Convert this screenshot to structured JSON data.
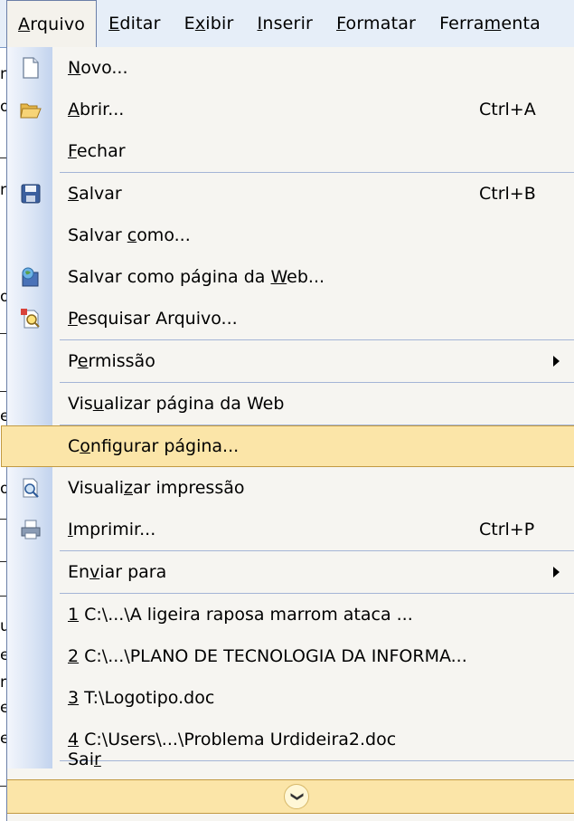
{
  "menubar": {
    "items": [
      {
        "pre": "",
        "ul": "A",
        "post": "rquivo"
      },
      {
        "pre": "",
        "ul": "E",
        "post": "ditar"
      },
      {
        "pre": "E",
        "ul": "x",
        "post": "ibir"
      },
      {
        "pre": "",
        "ul": "I",
        "post": "nserir"
      },
      {
        "pre": "",
        "ul": "F",
        "post": "ormatar"
      },
      {
        "pre": "Ferra",
        "ul": "m",
        "post": "enta"
      }
    ]
  },
  "menu": {
    "items": [
      {
        "pre": "",
        "ul": "N",
        "post": "ovo...",
        "shortcut": "",
        "icon": "new-document-icon"
      },
      {
        "pre": "",
        "ul": "A",
        "post": "brir...",
        "shortcut": "Ctrl+A",
        "icon": "open-folder-icon"
      },
      {
        "pre": "",
        "ul": "F",
        "post": "echar",
        "shortcut": "",
        "icon": ""
      },
      {
        "pre": "",
        "ul": "S",
        "post": "alvar",
        "shortcut": "Ctrl+B",
        "icon": "save-disk-icon"
      },
      {
        "pre": "Salvar ",
        "ul": "c",
        "post": "omo...",
        "shortcut": "",
        "icon": ""
      },
      {
        "pre": "Salvar como página da ",
        "ul": "W",
        "post": "eb...",
        "shortcut": "",
        "icon": "save-web-icon"
      },
      {
        "pre": "",
        "ul": "P",
        "post": "esquisar Arquivo...",
        "shortcut": "",
        "icon": "search-file-icon"
      },
      {
        "pre": "P",
        "ul": "e",
        "post": "rmissão",
        "shortcut": "",
        "icon": ""
      },
      {
        "pre": "Vis",
        "ul": "u",
        "post": "alizar página da Web",
        "shortcut": "",
        "icon": ""
      },
      {
        "pre": "C",
        "ul": "o",
        "post": "nfigurar página...",
        "shortcut": "",
        "icon": ""
      },
      {
        "pre": "Visuali",
        "ul": "z",
        "post": "ar impressão",
        "shortcut": "",
        "icon": "print-preview-icon"
      },
      {
        "pre": "",
        "ul": "I",
        "post": "mprimir...",
        "shortcut": "Ctrl+P",
        "icon": "printer-icon"
      },
      {
        "pre": "En",
        "ul": "v",
        "post": "iar para",
        "shortcut": "",
        "icon": ""
      },
      {
        "pre": "",
        "ul": "1",
        "post": " C:\\...\\A ligeira raposa marrom ataca ...",
        "shortcut": "",
        "icon": ""
      },
      {
        "pre": "",
        "ul": "2",
        "post": " C:\\...\\PLANO DE TECNOLOGIA DA INFORMA...",
        "shortcut": "",
        "icon": ""
      },
      {
        "pre": "",
        "ul": "3",
        "post": " T:\\Logotipo.doc",
        "shortcut": "",
        "icon": ""
      },
      {
        "pre": "",
        "ul": "4",
        "post": " C:\\Users\\...\\Problema Urdideira2.doc",
        "shortcut": "",
        "icon": ""
      },
      {
        "pre": "Sai",
        "ul": "r",
        "post": "",
        "shortcut": "",
        "icon": ""
      }
    ],
    "expand_icon": "double-chevron-down-icon"
  },
  "colors": {
    "highlight": "#fbe5a8",
    "highlight_border": "#c29a42",
    "menubar_bg": "#e6eef8",
    "menu_bg": "#f6f5f1"
  }
}
